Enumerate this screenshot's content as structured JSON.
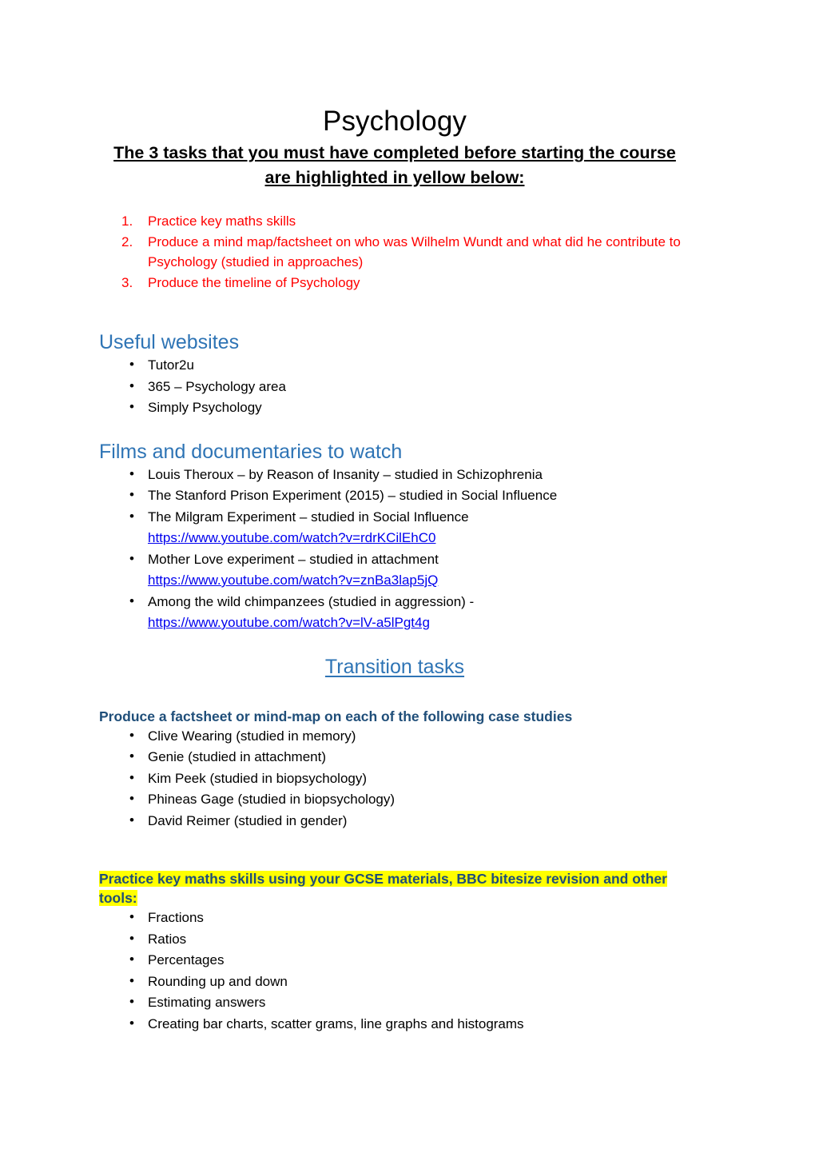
{
  "document": {
    "title": "Psychology",
    "subtitle": "The 3 tasks that you must have completed before starting the course are highlighted in yellow below:",
    "colors": {
      "title_text": "#000000",
      "required_tasks_text": "#FF0000",
      "heading_blue": "#2E74B5",
      "subheading_navy": "#1F4E79",
      "hyperlink": "#0000EE",
      "highlight": "#FFFF00",
      "page_background": "#FFFFFF"
    }
  },
  "required_tasks": {
    "items": [
      {
        "number": "1.",
        "text": "Practice key maths skills"
      },
      {
        "number": "2.",
        "text": "Produce a mind map/factsheet on who was Wilhelm Wundt and what did he contribute to Psychology (studied in approaches)"
      },
      {
        "number": "3.",
        "text": "Produce the timeline of Psychology"
      }
    ]
  },
  "useful_websites": {
    "heading": "Useful websites",
    "items": [
      "Tutor2u",
      "365 – Psychology area",
      "Simply Psychology"
    ]
  },
  "films_and_documentaries": {
    "heading": "Films and documentaries to watch",
    "items": [
      {
        "text": "Louis Theroux – by Reason of Insanity – studied in Schizophrenia",
        "link": ""
      },
      {
        "text": "The Stanford Prison Experiment (2015) – studied in Social Influence",
        "link": ""
      },
      {
        "text": "The Milgram Experiment – studied in Social Influence",
        "link": "https://www.youtube.com/watch?v=rdrKCilEhC0"
      },
      {
        "text": "Mother Love experiment – studied in attachment",
        "link": "https://www.youtube.com/watch?v=znBa3lap5jQ"
      },
      {
        "text": "Among the wild chimpanzees (studied in aggression) -",
        "link": "https://www.youtube.com/watch?v=lV-a5lPgt4g"
      }
    ]
  },
  "transition_tasks": {
    "heading": "Transition tasks",
    "case_studies": {
      "heading": "Produce a factsheet or mind-map on each of the following case studies",
      "items": [
        "Clive Wearing (studied in memory)",
        "Genie (studied in attachment)",
        "Kim Peek (studied in biopsychology)",
        "Phineas Gage (studied in biopsychology)",
        "David Reimer (studied in gender)"
      ]
    },
    "maths_skills": {
      "heading": "Practice key maths skills using your GCSE materials, BBC bitesize revision and other tools:",
      "highlighted": true,
      "items": [
        "Fractions",
        "Ratios",
        "Percentages",
        "Rounding up and down",
        "Estimating answers",
        "Creating bar charts, scatter grams, line graphs and histograms"
      ]
    }
  }
}
